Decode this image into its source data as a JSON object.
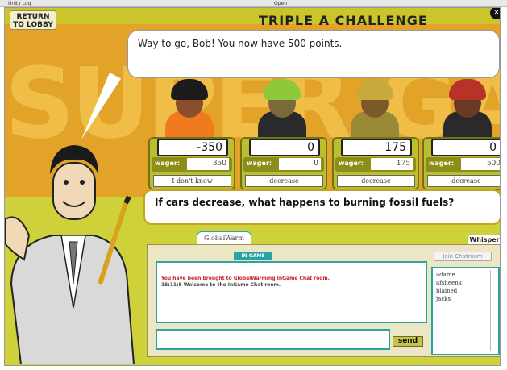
{
  "unity_log": {
    "label": "Unity Log",
    "open_label": "Open"
  },
  "header": {
    "return_button": "RETURN TO LOBBY",
    "show_title": "TRIPLE A CHALLENGE"
  },
  "backdrop_text": "SUPER GAME",
  "host": {
    "message": "Way to go, Bob! You now have 500 points."
  },
  "contestants": [
    {
      "score": "-350",
      "wager_label": "wager:",
      "wager": "350",
      "answer": "I don't know",
      "hair": "#1b1b1b",
      "shirt": "#f07a1e"
    },
    {
      "score": "0",
      "wager_label": "wager:",
      "wager": "0",
      "answer": "decrease",
      "hair": "#8ec93c",
      "shirt": "#2a2a2a"
    },
    {
      "score": "175",
      "wager_label": "wager:",
      "wager": "175",
      "answer": "decrease",
      "hair": "#c7a93c",
      "shirt": "#9a8a35"
    },
    {
      "score": "0",
      "wager_label": "wager:",
      "wager": "500",
      "answer": "decrease",
      "hair": "#b8322a",
      "shirt": "#2a2a2a"
    }
  ],
  "question": "If cars decrease, what happens to burning fossil fuels?",
  "chat": {
    "tab_label": "GlobalWarm",
    "whisper_label": "Whisper",
    "ingame_label": "IN GAME",
    "join_label": "Join Chatroom",
    "send_label": "send",
    "messages": [
      {
        "text": "You have been brought to GlobalWarming InGame Chat room.",
        "color": "#c8232c"
      },
      {
        "text": "15:11:5 Welcome to the InGame Chat room.",
        "color": "#444444"
      }
    ],
    "users": [
      "adame",
      "afsheenk",
      "blained",
      "jacks"
    ]
  }
}
